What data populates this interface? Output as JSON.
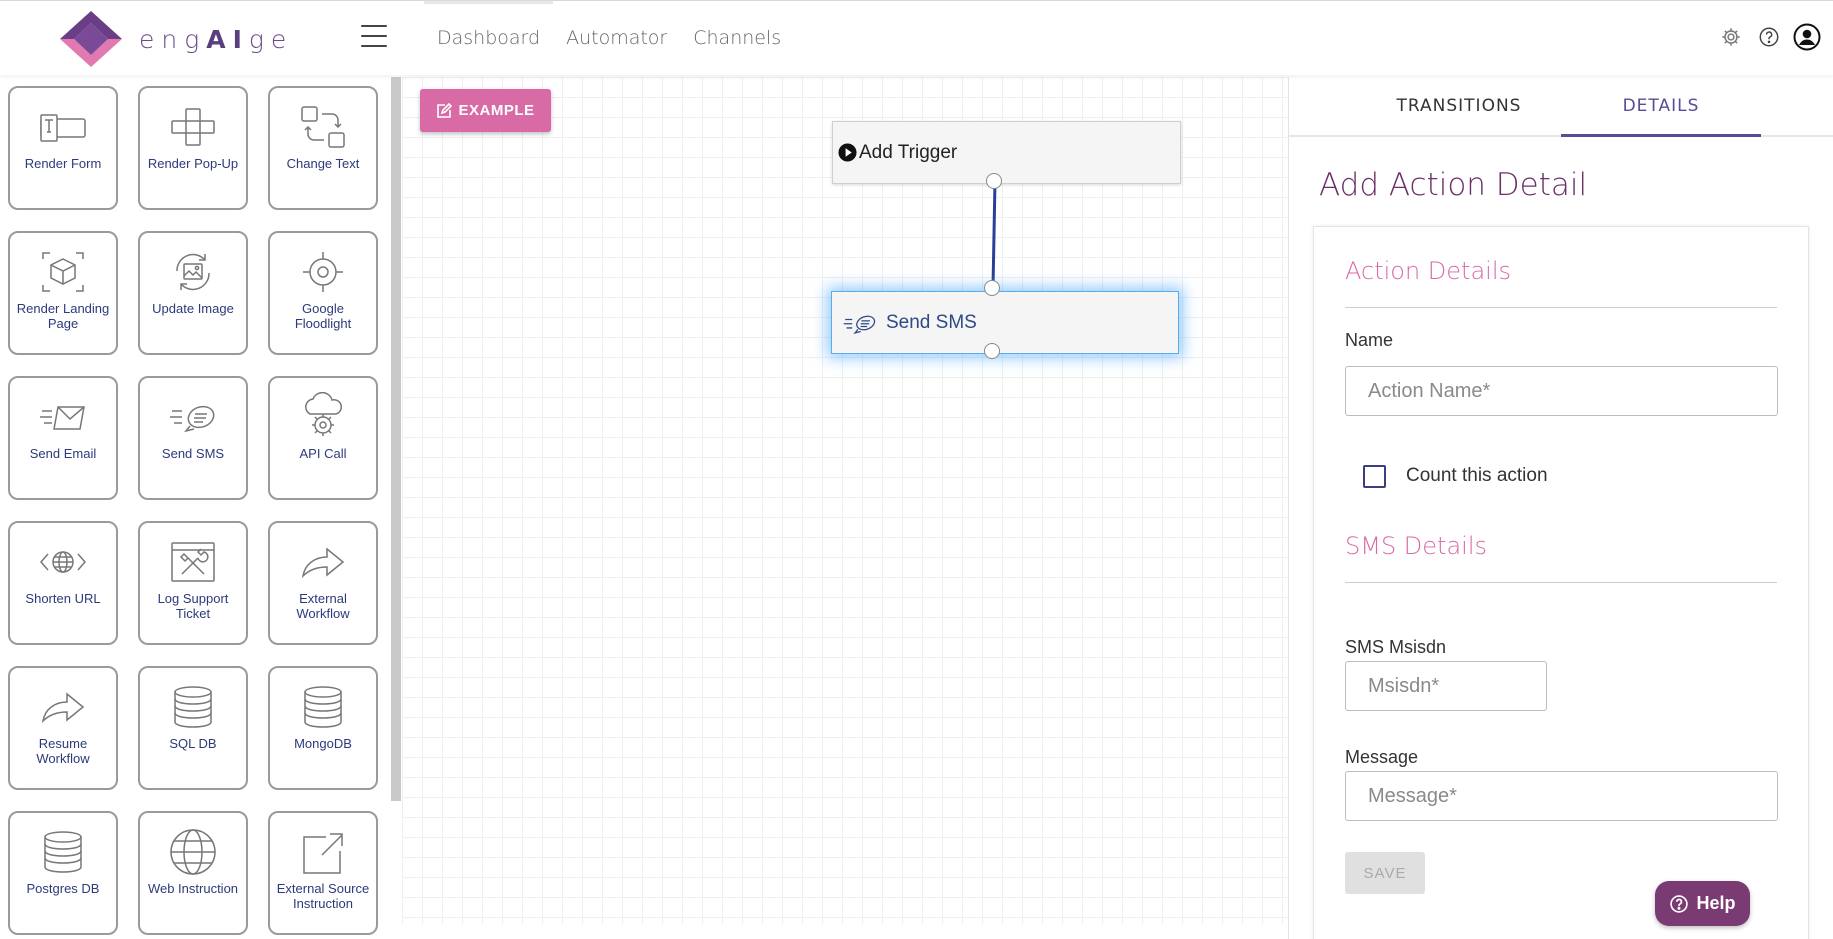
{
  "header": {
    "brand_prefix": "eng",
    "brand_highlight": "AI",
    "brand_suffix": "ge",
    "nav": [
      {
        "label": "Dashboard"
      },
      {
        "label": "Automator"
      },
      {
        "label": "Channels"
      }
    ],
    "icons": [
      "gear-icon",
      "help-circle-icon",
      "user-account-icon"
    ]
  },
  "palette": {
    "tiles": [
      {
        "label": "Render Form",
        "icon": "form-field-icon"
      },
      {
        "label": "Render Pop-Up",
        "icon": "popup-icon"
      },
      {
        "label": "Change Text",
        "icon": "swap-icon"
      },
      {
        "label": "Render Landing Page",
        "icon": "cube-icon"
      },
      {
        "label": "Update Image",
        "icon": "image-refresh-icon"
      },
      {
        "label": "Google Floodlight",
        "icon": "target-icon"
      },
      {
        "label": "Send Email",
        "icon": "email-icon"
      },
      {
        "label": "Send SMS",
        "icon": "sms-icon"
      },
      {
        "label": "API Call",
        "icon": "cloud-gear-icon"
      },
      {
        "label": "Shorten URL",
        "icon": "globe-code-icon"
      },
      {
        "label": "Log Support Ticket",
        "icon": "tools-icon"
      },
      {
        "label": "External Workflow",
        "icon": "forward-arrow-icon"
      },
      {
        "label": "Resume Workflow",
        "icon": "forward-arrow-icon"
      },
      {
        "label": "SQL DB",
        "icon": "database-icon"
      },
      {
        "label": "MongoDB",
        "icon": "database-icon"
      },
      {
        "label": "Postgres DB",
        "icon": "database-icon"
      },
      {
        "label": "Web Instruction",
        "icon": "globe-icon"
      },
      {
        "label": "External Source Instruction",
        "icon": "external-link-icon"
      }
    ]
  },
  "canvas": {
    "example_label": "EXAMPLE",
    "trigger_label": "Add Trigger",
    "sms_label": "Send SMS"
  },
  "panel": {
    "tabs": [
      {
        "label": "TRANSITIONS"
      },
      {
        "label": "DETAILS",
        "active": true
      }
    ],
    "title": "Add Action Detail",
    "action_section": "Action Details",
    "name_label": "Name",
    "name_placeholder": "Action Name*",
    "count_label": "Count this action",
    "sms_section": "SMS Details",
    "msisdn_label": "SMS Msisdn",
    "msisdn_placeholder": "Msisdn*",
    "message_label": "Message",
    "message_placeholder": "Message*",
    "save_label": "SAVE",
    "help_label": "Help"
  },
  "colors": {
    "brand_purple": "#6b2e66",
    "accent_pink": "#d86aa6",
    "tab_active": "#5b4a9a",
    "tile_text": "#2d3a7a"
  }
}
